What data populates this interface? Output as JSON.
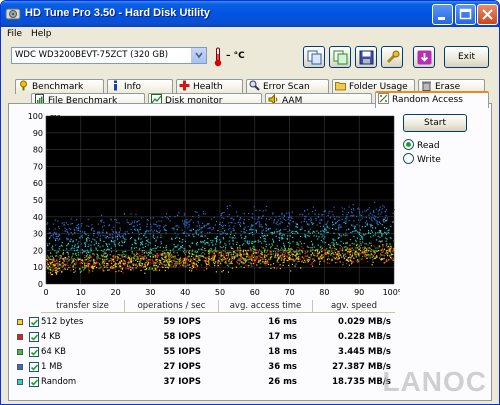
{
  "window": {
    "title": "HD Tune Pro 3.50 - Hard Disk Utility"
  },
  "menu": {
    "items": [
      "File",
      "Help"
    ]
  },
  "toolbar": {
    "drive": "WDC WD3200BEVT-75ZCT (320 GB)",
    "temperature": "– °C",
    "exit_label": "Exit"
  },
  "tabs_row1": [
    "Benchmark",
    "Info",
    "Health",
    "Error Scan",
    "Folder Usage",
    "Erase"
  ],
  "tabs_row2": [
    "File Benchmark",
    "Disk monitor",
    "AAM",
    "Random Access"
  ],
  "active_tab": "Random Access",
  "controls": {
    "start_label": "Start",
    "read_label": "Read",
    "write_label": "Write",
    "mode": "Read"
  },
  "chart_data": {
    "type": "scatter",
    "ylabel": "ms",
    "ylim": [
      0,
      100
    ],
    "xlim": [
      0,
      100
    ],
    "yticks": [
      "100",
      "90",
      "80",
      "70",
      "60",
      "50",
      "40",
      "30",
      "20",
      "10",
      "0"
    ],
    "xticks": [
      "0",
      "10",
      "20",
      "30",
      "40",
      "50",
      "60",
      "70",
      "80",
      "90",
      "100%"
    ],
    "grid": true,
    "series": [
      {
        "name": "512 bytes",
        "color": "#ffd21a",
        "values_ms": {
          "min": 6,
          "max": 28,
          "mean": 16
        }
      },
      {
        "name": "4 KB",
        "color": "#e02020",
        "values_ms": {
          "min": 7,
          "max": 28,
          "mean": 17
        }
      },
      {
        "name": "64 KB",
        "color": "#3ac63a",
        "values_ms": {
          "min": 8,
          "max": 30,
          "mean": 18
        }
      },
      {
        "name": "1 MB",
        "color": "#2a6ed4",
        "values_ms": {
          "min": 20,
          "max": 50,
          "mean": 36
        }
      },
      {
        "name": "Random",
        "color": "#2ad2d2",
        "values_ms": {
          "min": 15,
          "max": 45,
          "mean": 26
        }
      }
    ]
  },
  "results": {
    "headers": [
      "transfer size",
      "operations / sec",
      "avg. access time",
      "agv. speed"
    ],
    "rows": [
      {
        "label": "512 bytes",
        "color": "#ffd21a",
        "ops": "59 IOPS",
        "access": "16 ms",
        "speed": "0.029 MB/s"
      },
      {
        "label": "4 KB",
        "color": "#e02020",
        "ops": "58 IOPS",
        "access": "17 ms",
        "speed": "0.228 MB/s"
      },
      {
        "label": "64 KB",
        "color": "#3ac63a",
        "ops": "55 IOPS",
        "access": "18 ms",
        "speed": "3.445 MB/s"
      },
      {
        "label": "1 MB",
        "color": "#2a6ed4",
        "ops": "27 IOPS",
        "access": "36 ms",
        "speed": "27.387 MB/s"
      },
      {
        "label": "Random",
        "color": "#2ad2d2",
        "ops": "37 IOPS",
        "access": "26 ms",
        "speed": "18.735 MB/s"
      }
    ]
  },
  "watermark": "LANOC"
}
